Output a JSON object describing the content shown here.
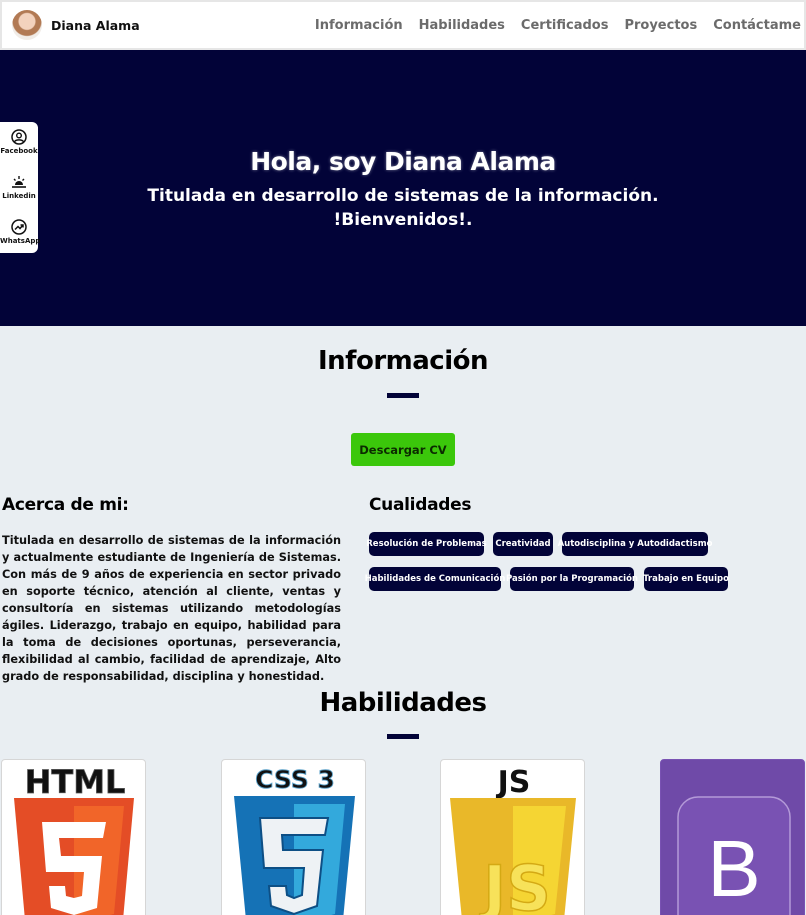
{
  "header": {
    "brand_name": "Diana Alama",
    "nav": [
      {
        "label": "Información"
      },
      {
        "label": "Habilidades"
      },
      {
        "label": "Certificados"
      },
      {
        "label": "Proyectos"
      },
      {
        "label": "Contáctame"
      }
    ]
  },
  "hero": {
    "title": "Hola, soy Diana Alama",
    "subtitle": "Titulada en desarrollo de sistemas de la información.",
    "welcome": "!Bienvenidos!."
  },
  "social": [
    {
      "label": "Facebook",
      "icon": "user-circle-icon"
    },
    {
      "label": "Linkedin",
      "icon": "sunrise-icon"
    },
    {
      "label": "WhatsApp",
      "icon": "trending-up-icon"
    }
  ],
  "info": {
    "title": "Información",
    "cv_button": "Descargar CV",
    "about_title": "Acerca de mi:",
    "about_text": "Titulada en desarrollo de sistemas de la información y actualmente estudiante de Ingeniería de Sistemas. Con más de 9 años de experiencia en sector privado en soporte técnico, atención al cliente, ventas y consultoría en sistemas utilizando metodologías ágiles. Liderazgo, trabajo en equipo, habilidad para la toma de decisiones oportunas, perseverancia, flexibilidad al cambio, facilidad de aprendizaje, Alto grado de responsabilidad, disciplina y honestidad.",
    "qualities_title": "Cualidades",
    "qualities": [
      "Resolución de Problemas",
      "Creatividad",
      "Autodisciplina y Autodidactismo",
      "Habilidades de Comunicación",
      "Pasión por la Programación",
      "Trabajo en Equipo"
    ]
  },
  "skills": {
    "title": "Habilidades",
    "items": [
      {
        "logo_text": "HTML",
        "badge": "5",
        "icon": "html5-logo"
      },
      {
        "logo_text": "CSS 3",
        "badge": "3",
        "icon": "css3-logo"
      },
      {
        "logo_text": "JS",
        "badge": "JS",
        "icon": "javascript-logo"
      },
      {
        "logo_text": "B",
        "icon": "bootstrap-logo"
      }
    ]
  },
  "colors": {
    "navy": "#020338",
    "green_button": "#3bc70b",
    "page_bg": "#e9eef2"
  }
}
